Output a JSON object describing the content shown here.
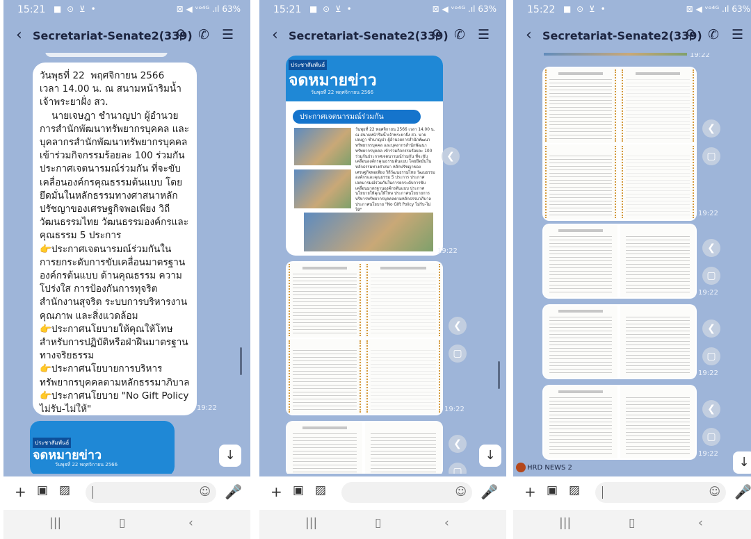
{
  "phones": [
    {
      "status": {
        "time": "15:21",
        "left_icons": "■ ⊙ ⊻ •",
        "right": "⊠ ◀ ᵛᵒ⁴ᴳ .ıl 63%"
      },
      "header": {
        "title": "Secretariat-Senate2(339)"
      },
      "message": {
        "text": "วันพุธที่ 22  พฤศจิกายน 2566\nเวลา 14.00 น. ณ สนามหน้าริมน้ำ\nเจ้าพระยาฝั่ง สว.\n    นายเจษฎา ชำนาญปา ผู้อำนวย\nการสำนักพัฒนาทรัพยากรบุคคล และ\nบุคลากรสำนักพัฒนาทรัพยากรบุคคล\nเข้าร่วมกิจกรรมร้อยละ 100 ร่วมกัน\nประกาศเจตนารมณ์ร่วมกัน ที่จะขับ\nเคลื่อนองค์กรคุณธรรมต้นแบบ โดย\nยึดมั่นในหลักธรรมทางศาสนาหลัก\nปรัชญาของเศรษฐกิจพอเพียง วิถี\nวัฒนธรรมไทย วัฒนธรรมองค์กรและ\nคุณธรรม 5 ประการ\n👉ประกาศเจตนารมณ์ร่วมกันใน\nการยกระดับการขับเคลื่อนมาตรฐาน\nองค์กรต้นแบบ ด้านคุณธรรม ความ\nโปร่งใส การป้องกันการทุจริต\nสำนักงานสุจริต ระบบการบริหารงาน\nคุณภาพ และสิ่งแวดล้อม\n👉ประกาศนโยบายให้คุณให้โทษ\nสำหรับการปฏิบัติหรือฝ่าฝืนมาตรฐาน\nทางจริยธรรม\n👉ประกาศนโยบายการบริหาร\nทรัพยากรบุคคลตามหลักธรรมาภิบาล\n👉ประกาศนโยบาย \"No Gift Policy\nไม่รับ-ไม่ให้\"",
        "time": "19:22"
      }
    },
    {
      "status": {
        "time": "15:21",
        "left_icons": "■ ⊙ ⊻ •",
        "right": "⊠ ◀ ᵛᵒ⁴ᴳ .ıl 63%"
      },
      "header": {
        "title": "Secretariat-Senate2(339)"
      },
      "times": [
        "19:22",
        "19:22"
      ]
    },
    {
      "status": {
        "time": "15:22",
        "left_icons": "■ ⊙ ⊻ •",
        "right": "⊠ ◀ ᵛᵒ⁴ᴳ .ıl 63%"
      },
      "header": {
        "title": "Secretariat-Senate2(339)"
      },
      "times": [
        "19:22",
        "19:22",
        "19:22",
        "19:22",
        "19:22"
      ],
      "sender": "HRD NEWS 2"
    }
  ],
  "newsletter": {
    "label": "ประชาสัมพันธ์",
    "title": "จดหมายข่าว",
    "date": "วันพุธที่ 22 พฤศจิกายน 2566",
    "banner": "ประกาศเจตนารมณ์ร่วมกัน",
    "body": "วันพุธที่ 22 พฤศจิกายน 2566 เวลา 14.00 น. ณ สนามหน้าริมน้ำเจ้าพระยาฝั่ง สว. นายเจษฎา ชำนาญปา ผู้อำนวยการสำนักพัฒนาทรัพยากรบุคคล และบุคลากรสำนักพัฒนาทรัพยากรบุคคล เข้าร่วมกิจกรรมร้อยละ 100 ร่วมกันประกาศเจตนารมณ์ร่วมกัน ที่จะขับเคลื่อนองค์กรคุณธรรมต้นแบบ โดยยึดมั่นในหลักธรรมทางศาสนา หลักปรัชญาของเศรษฐกิจพอเพียง วิถีวัฒนธรรมไทย วัฒนธรรมองค์กรและคุณธรรม 5 ประการ ประกาศเจตนารมณ์ร่วมกันในการยกระดับการขับเคลื่อนมาตรฐานองค์กรต้นแบบ ประกาศนโยบายให้คุณให้โทษ ประกาศนโยบายการบริหารทรัพยากรบุคคลตามหลักธรรมาภิบาล ประกาศนโยบาย \"No Gift Policy ไม่รับ-ไม่ให้\""
  },
  "icons": {
    "back": "back-arrow-icon",
    "search": "search-icon",
    "call": "phone-icon",
    "menu": "menu-icon",
    "share": "share-icon",
    "capture": "capture-icon",
    "down": "scroll-down-icon",
    "plus": "plus-icon",
    "camera": "camera-icon",
    "image": "image-icon",
    "emoji": "emoji-icon",
    "mic": "microphone-icon",
    "recents": "recents-icon",
    "home": "home-icon",
    "nav_back": "nav-back-icon"
  },
  "colors": {
    "chat_bg": "#9eb5d9",
    "accent": "#1f88d6",
    "bubble": "#ffffff"
  }
}
